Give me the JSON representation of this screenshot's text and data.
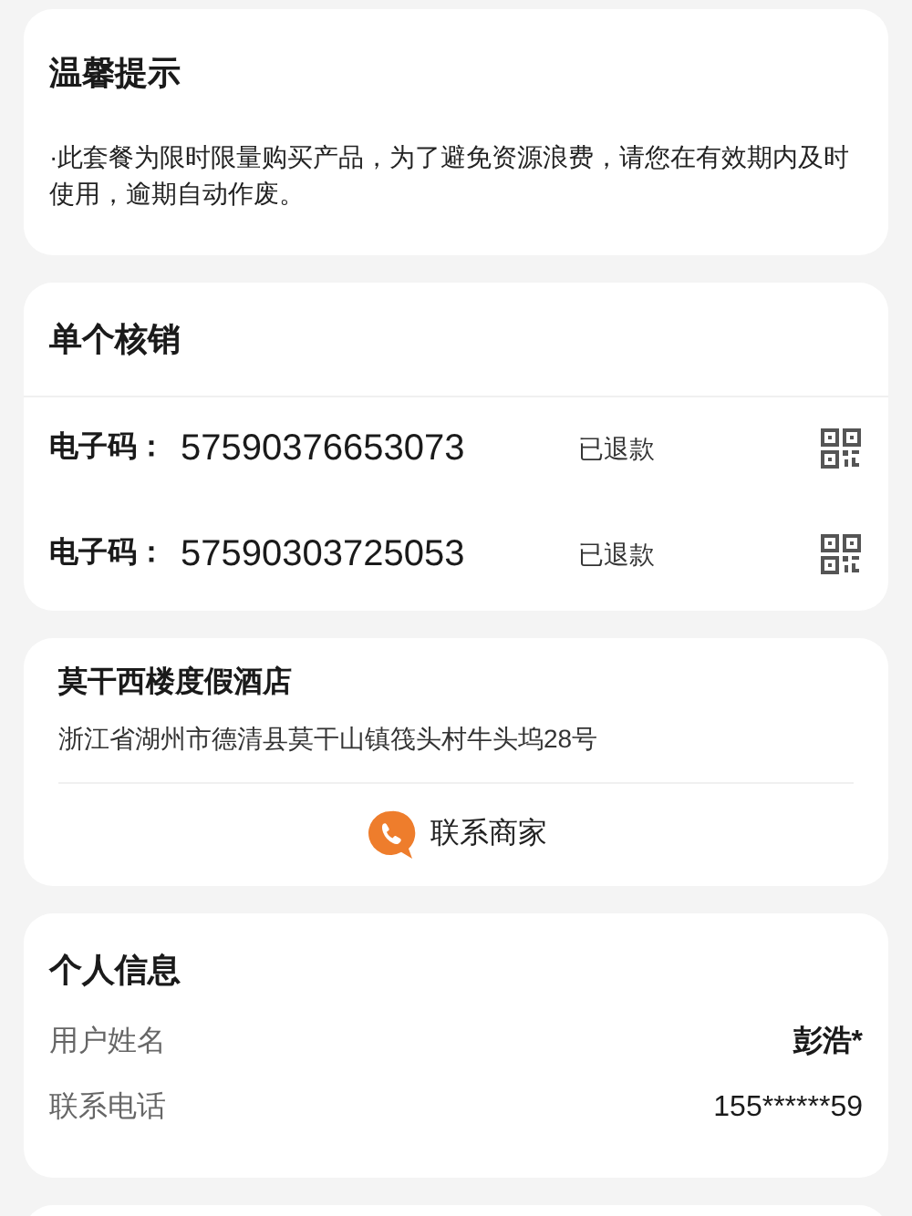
{
  "tips": {
    "title": "温馨提示",
    "text": "·此套餐为限时限量购买产品，为了避免资源浪费，请您在有效期内及时使用，逾期自动作废。"
  },
  "verify": {
    "title": "单个核销",
    "codes": [
      {
        "label": "电子码：",
        "code": "57590376653073",
        "status": "已退款"
      },
      {
        "label": "电子码：",
        "code": "57590303725053",
        "status": "已退款"
      }
    ]
  },
  "store": {
    "name": "莫干西楼度假酒店",
    "address": "浙江省湖州市德清县莫干山镇筏头村牛头坞28号",
    "contact": "联系商家"
  },
  "personal": {
    "title": "个人信息",
    "fields": [
      {
        "label": "用户姓名",
        "value": "彭浩*"
      },
      {
        "label": "联系电话",
        "value": "155******59"
      }
    ]
  }
}
